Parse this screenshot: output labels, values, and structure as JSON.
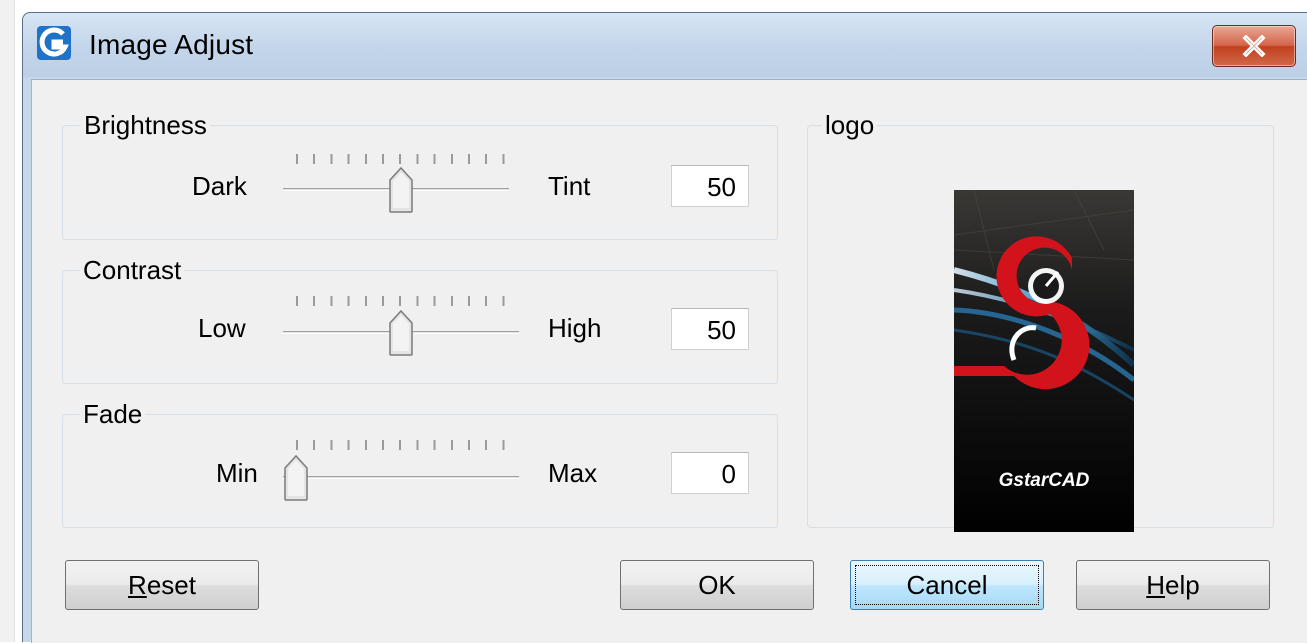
{
  "window": {
    "title": "Image Adjust"
  },
  "brightness": {
    "label": "Brightness",
    "min_label": "Dark",
    "max_label": "Tint",
    "value": "50",
    "level": 50
  },
  "contrast": {
    "label": "Contrast",
    "min_label": "Low",
    "max_label": "High",
    "value": "50",
    "level": 50
  },
  "fade": {
    "label": "Fade",
    "min_label": "Min",
    "max_label": "Max",
    "value": "0",
    "level": 0
  },
  "logo": {
    "label": "logo",
    "brand_text": "GstarCAD"
  },
  "buttons": {
    "reset_first": "R",
    "reset_rest": "eset",
    "ok": "OK",
    "cancel": "Cancel",
    "help_first": "H",
    "help_rest": "elp"
  },
  "colors": {
    "title_bar": "#c6d7ea",
    "dialog_bg": "#f0f0f0",
    "close_red": "#c8452a",
    "logo_red": "#d2131b"
  },
  "icons": {
    "app": "gstarcad-app-icon",
    "close": "close-icon"
  }
}
